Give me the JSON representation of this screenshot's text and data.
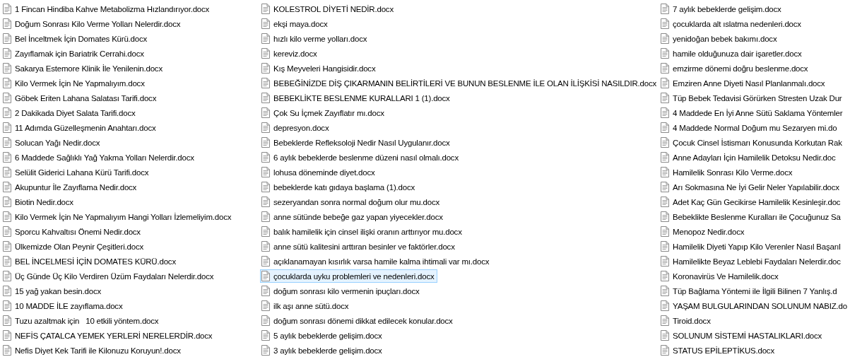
{
  "columns": [
    {
      "items": [
        {
          "name": "1 Fincan Hindiba Kahve Metabolizma Hızlandırıyor.docx",
          "selected": false
        },
        {
          "name": "Doğum Sonrası Kilo Verme Yolları Nelerdir.docx",
          "selected": false
        },
        {
          "name": "Bel İnceltmek İçin Domates Kürü.docx",
          "selected": false
        },
        {
          "name": "Zayıflamak için Bariatrik Cerrahi.docx",
          "selected": false
        },
        {
          "name": "Sakarya Estemore Klinik İle Yenilenin.docx",
          "selected": false
        },
        {
          "name": "Kilo Vermek İçin Ne Yapmalıyım.docx",
          "selected": false
        },
        {
          "name": "Göbek Eriten Lahana Salatası Tarifi.docx",
          "selected": false
        },
        {
          "name": "2 Dakikada Diyet Salata Tarifi.docx",
          "selected": false
        },
        {
          "name": "11 Adımda Güzelleşmenin Anahtarı.docx",
          "selected": false
        },
        {
          "name": "Solucan Yağı Nedir.docx",
          "selected": false
        },
        {
          "name": "6 Maddede Sağlıklı Yağ Yakma Yolları Nelerdir.docx",
          "selected": false
        },
        {
          "name": "Selülit Giderici Lahana Kürü Tarifi.docx",
          "selected": false
        },
        {
          "name": "Akupuntur İle Zayıflama Nedir.docx",
          "selected": false
        },
        {
          "name": "Biotin Nedir.docx",
          "selected": false
        },
        {
          "name": "Kilo Vermek İçin Ne Yapmalıyım Hangi Yolları İzlemeliyim.docx",
          "selected": false
        },
        {
          "name": "Sporcu Kahvaltısı Önemi Nedir.docx",
          "selected": false
        },
        {
          "name": "Ülkemizde Olan Peynir Çeşitleri.docx",
          "selected": false
        },
        {
          "name": "BEL İNCELMESİ İÇİN DOMATES KÜRÜ.docx",
          "selected": false
        },
        {
          "name": "Üç Günde Üç Kilo Verdiren Üzüm Faydaları Nelerdir.docx",
          "selected": false
        },
        {
          "name": "15 yağ yakan besin.docx",
          "selected": false
        },
        {
          "name": "10 MADDE İLE zayıflama.docx",
          "selected": false
        },
        {
          "name": "Tuzu azaltmak için   10 etkili yöntem.docx",
          "selected": false
        },
        {
          "name": "NEFİS ÇATALCA YEMEK YERLERİ NERELERDİR.docx",
          "selected": false
        },
        {
          "name": "Nefis Diyet Kek Tarifi ile Kilonuzu Koruyun!.docx",
          "selected": false
        }
      ]
    },
    {
      "items": [
        {
          "name": "KOLESTROL DİYETİ NEDİR.docx",
          "selected": false
        },
        {
          "name": "ekşi maya.docx",
          "selected": false
        },
        {
          "name": "hızlı kilo verme yolları.docx",
          "selected": false
        },
        {
          "name": "kereviz.docx",
          "selected": false
        },
        {
          "name": "Kış Meyveleri Hangisidir.docx",
          "selected": false
        },
        {
          "name": "BEBEĞİNİZDE DİŞ ÇIKARMANIN BELİRTİLERİ VE BUNUN BESLENME İLE OLAN İLİŞKİSİ NASILDIR.docx",
          "selected": false
        },
        {
          "name": "BEBEKLİKTE BESLENME KURALLARI 1 (1).docx",
          "selected": false
        },
        {
          "name": "Çok Su İçmek Zayıflatır mı.docx",
          "selected": false
        },
        {
          "name": "depresyon.docx",
          "selected": false
        },
        {
          "name": "Bebeklerde Refleksoloji Nedir Nasıl Uygulanır.docx",
          "selected": false
        },
        {
          "name": "6 aylık bebeklerde beslenme düzeni nasıl olmalı.docx",
          "selected": false
        },
        {
          "name": "lohusa döneminde diyet.docx",
          "selected": false
        },
        {
          "name": "bebeklerde katı gıdaya başlama (1).docx",
          "selected": false
        },
        {
          "name": "sezeryandan sonra normal doğum olur mu.docx",
          "selected": false
        },
        {
          "name": "anne sütünde bebeğe gaz yapan yiyecekler.docx",
          "selected": false
        },
        {
          "name": "balık hamilelik için cinsel ilişki oranın arttırıyor mu.docx",
          "selected": false
        },
        {
          "name": "anne sütü kalitesini arttıran besinler ve faktörler.docx",
          "selected": false
        },
        {
          "name": "açıklanamayan kısırlık varsa hamile kalma ihtimali var mı.docx",
          "selected": false
        },
        {
          "name": "çocuklarda uyku problemleri ve nedenleri.docx",
          "selected": true
        },
        {
          "name": "doğum sonrası kilo vermenin ipuçları.docx",
          "selected": false
        },
        {
          "name": "ilk aşı anne sütü.docx",
          "selected": false
        },
        {
          "name": "doğum sonrası dönemi dikkat edilecek konular.docx",
          "selected": false
        },
        {
          "name": "5 aylık bebeklerde gelişim.docx",
          "selected": false
        },
        {
          "name": "3 aylık bebeklerde gelişim.docx",
          "selected": false
        }
      ]
    },
    {
      "items": [
        {
          "name": "7 aylık bebeklerde gelişim.docx",
          "selected": false
        },
        {
          "name": "çocuklarda alt ıslatma nedenleri.docx",
          "selected": false
        },
        {
          "name": "yenidoğan bebek bakımı.docx",
          "selected": false
        },
        {
          "name": "hamile olduğunuza dair işaretler.docx",
          "selected": false
        },
        {
          "name": "emzirme dönemi doğru beslenme.docx",
          "selected": false
        },
        {
          "name": "Emziren Anne Diyeti Nasıl Planlanmalı.docx",
          "selected": false
        },
        {
          "name": "Tüp Bebek Tedavisi Görürken Stresten Uzak Dur",
          "selected": false
        },
        {
          "name": "4 Maddede En İyi Anne Sütü Saklama Yöntemler",
          "selected": false
        },
        {
          "name": "4 Maddede Normal Doğum mu Sezaryen mi.do",
          "selected": false
        },
        {
          "name": "Çocuk Cinsel İstismarı Konusunda Korkutan Rak",
          "selected": false
        },
        {
          "name": "Anne Adayları İçin Hamilelik Detoksu Nedir.doc",
          "selected": false
        },
        {
          "name": "Hamilelik Sonrası Kilo Verme.docx",
          "selected": false
        },
        {
          "name": "Arı Sokmasına Ne İyi Gelir Neler Yapılabilir.docx",
          "selected": false
        },
        {
          "name": "Adet Kaç Gün Gecikirse Hamilelik Kesinleşir.doc",
          "selected": false
        },
        {
          "name": "Bebeklikte Beslenme Kuralları ile Çocuğunuz Sa",
          "selected": false
        },
        {
          "name": "Menopoz Nedir.docx",
          "selected": false
        },
        {
          "name": "Hamilelik Diyeti Yapıp Kilo Verenler Nasıl Başarıl",
          "selected": false
        },
        {
          "name": "Hamilelikte Beyaz Leblebi Faydaları Nelerdir.doc",
          "selected": false
        },
        {
          "name": "Koronavirüs Ve Hamilelik.docx",
          "selected": false
        },
        {
          "name": "Tüp Bağlama Yöntemi ile İlgili Bilinen 7 Yanlış.d",
          "selected": false
        },
        {
          "name": "YAŞAM BULGULARINDAN SOLUNUM NABIZ.do",
          "selected": false
        },
        {
          "name": "Tiroid.docx",
          "selected": false
        },
        {
          "name": "SOLUNUM SİSTEMİ HASTALIKLARI.docx",
          "selected": false
        },
        {
          "name": "STATUS EPİLEPTİKUS.docx",
          "selected": false
        }
      ]
    }
  ]
}
